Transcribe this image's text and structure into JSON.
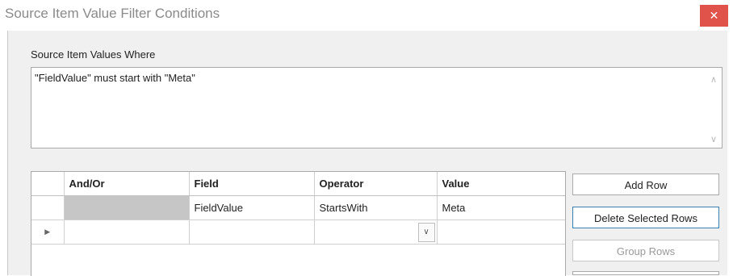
{
  "window": {
    "title": "Source Item Value Filter Conditions",
    "close_glyph": "✕"
  },
  "where_label": "Source Item Values Where",
  "expression": "\"FieldValue\" must start with \"Meta\"",
  "grid": {
    "columns": [
      "And/Or",
      "Field",
      "Operator",
      "Value"
    ],
    "rows": [
      {
        "and_or": "",
        "field": "FieldValue",
        "operator": "StartsWith",
        "value": "Meta"
      },
      {
        "and_or": "",
        "field": "",
        "operator": "",
        "value": ""
      }
    ],
    "current_row_glyph": "▶",
    "dropdown_glyph": "∨"
  },
  "buttons": {
    "add_row": "Add Row",
    "delete_selected_rows": "Delete Selected Rows",
    "group_rows": "Group Rows"
  },
  "icons": {
    "scroll_up": "∧",
    "scroll_down": "∨"
  }
}
